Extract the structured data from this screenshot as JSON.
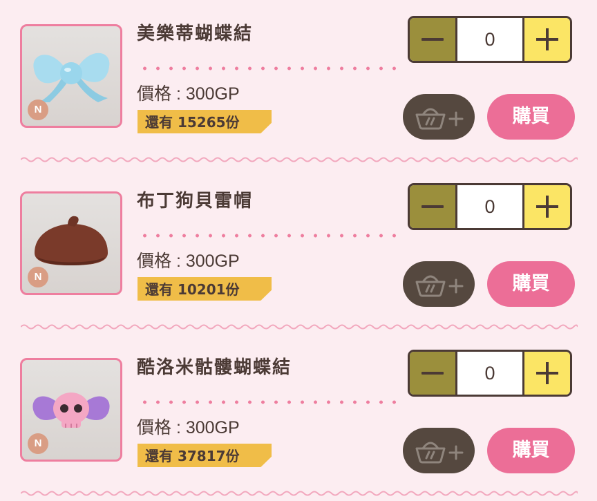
{
  "price_prefix": "價格 : ",
  "stock_prefix": "還有 ",
  "stock_suffix": "份",
  "buy_label": "購買",
  "rarity_label": "N",
  "items": [
    {
      "name": "美樂蒂蝴蝶結",
      "price_text": "價格 : 300GP",
      "stock_text": "還有 15265份",
      "quantity": "0",
      "buy_label": "購買",
      "rarity": "N",
      "thumbnail_icon": "blue-bow-icon"
    },
    {
      "name": "布丁狗貝雷帽",
      "price_text": "價格 : 300GP",
      "stock_text": "還有 10201份",
      "quantity": "0",
      "buy_label": "購買",
      "rarity": "N",
      "thumbnail_icon": "brown-beret-icon"
    },
    {
      "name": "酷洛米骷髏蝴蝶結",
      "price_text": "價格 : 300GP",
      "stock_text": "還有 37817份",
      "quantity": "0",
      "buy_label": "購買",
      "rarity": "N",
      "thumbnail_icon": "skull-bow-icon"
    }
  ],
  "colors": {
    "background": "#fcedf1",
    "pink_accent": "#ee7e9f",
    "buy_button": "#ec6e97",
    "stock_tag": "#f0bd48",
    "minus_button": "#9b8f3c",
    "plus_button": "#fbe565",
    "text_dark": "#4b3a35",
    "cart_button": "#55483f"
  }
}
